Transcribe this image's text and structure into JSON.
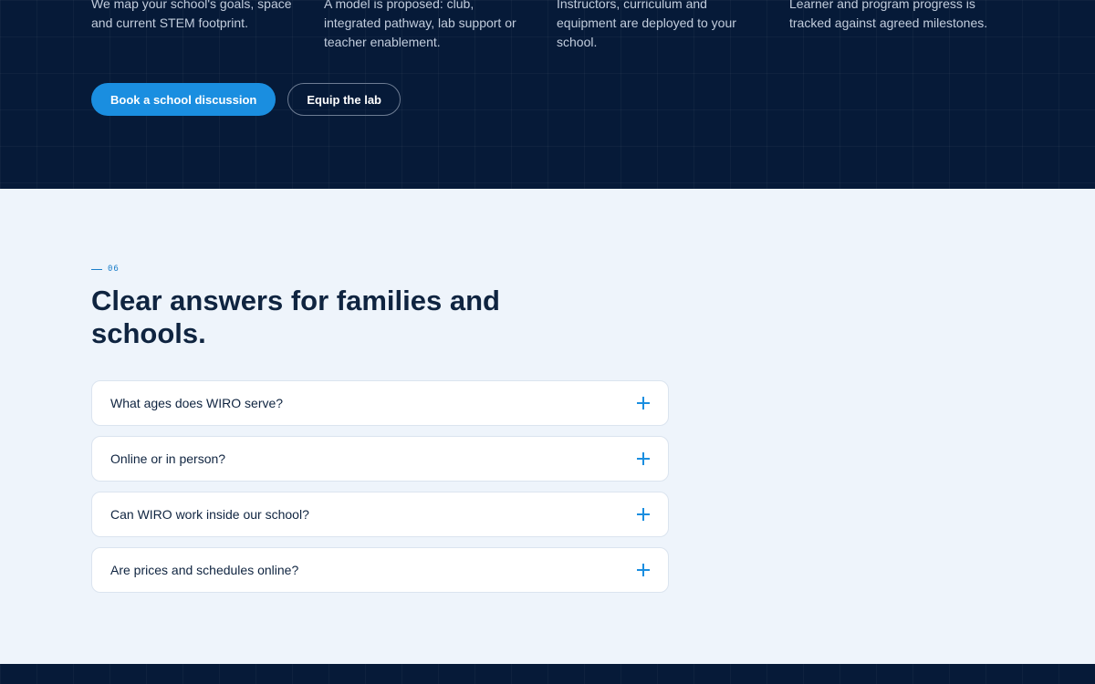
{
  "process_steps": [
    {
      "text": "We map your school's goals, space and current STEM footprint."
    },
    {
      "text": "A model is proposed: club, integrated pathway, lab support or teacher enablement."
    },
    {
      "text": "Instructors, curriculum and equipment are deployed to your school."
    },
    {
      "text": "Learner and program progress is tracked against agreed milestones."
    }
  ],
  "actions": {
    "primary_label": "Book a school discussion",
    "secondary_label": "Equip the lab"
  },
  "faq": {
    "eyebrow": "06",
    "title": "Clear answers for families and schools.",
    "items": [
      {
        "question": "What ages does WIRO serve?"
      },
      {
        "question": "Online or in person?"
      },
      {
        "question": "Can WIRO work inside our school?"
      },
      {
        "question": "Are prices and schedules online?"
      }
    ]
  },
  "colors": {
    "dark_band": "#061a38",
    "accent": "#1a8ee0",
    "page_bg": "#eef4fb"
  },
  "icons": {
    "faq_toggle": "plus-icon"
  }
}
